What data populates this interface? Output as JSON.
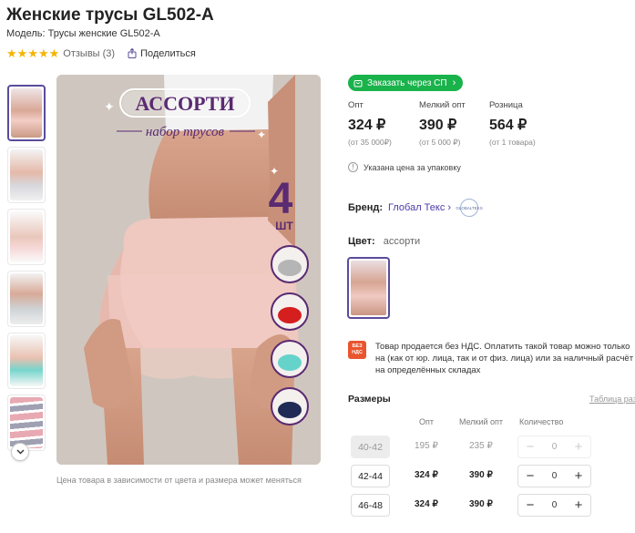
{
  "product": {
    "title": "Женские трусы GL502-A",
    "model": "Модель: Трусы женские GL502-A",
    "rating_stars": 5,
    "reviews": "Отзывы (3)",
    "share": "Поделиться"
  },
  "gallery": {
    "image_title": "АССОРТИ",
    "image_subtitle": "набор трусов",
    "image_count": "4",
    "image_count_unit": "ШТ",
    "caption": "Цена товара в зависимости от цвета и размера может меняться"
  },
  "order_button": "Заказать через СП",
  "prices": [
    {
      "label": "Опт",
      "value": "324 ₽",
      "note": "(от 35 000₽)"
    },
    {
      "label": "Мелкий опт",
      "value": "390 ₽",
      "note": "(от 5 000 ₽)"
    },
    {
      "label": "Розница",
      "value": "564 ₽",
      "note": "(от 1 товара)"
    }
  ],
  "price_info": "Указана цена за упаковку",
  "brand": {
    "label": "Бренд:",
    "value": "Глобал Текс",
    "logo_text": "GLOBALTEKS"
  },
  "color": {
    "label": "Цвет:",
    "value": "ассорти"
  },
  "vat": {
    "badge_line1": "БЕЗ",
    "badge_line2": "НДС",
    "text": "Товар продается без НДС. Оплатить такой товар можно только на (как от юр. лица, так и от физ. лица) или за наличный расчёт на определённых складах"
  },
  "sizes": {
    "title": "Размеры",
    "table_link": "Таблица раз",
    "headers": {
      "opt": "Опт",
      "small_opt": "Мелкий опт",
      "qty": "Количество"
    },
    "rows": [
      {
        "size": "40-42",
        "opt": "195 ₽",
        "small_opt": "235 ₽",
        "qty": "0",
        "disabled": true
      },
      {
        "size": "42-44",
        "opt": "324 ₽",
        "small_opt": "390 ₽",
        "qty": "0",
        "disabled": false
      },
      {
        "size": "46-48",
        "opt": "324 ₽",
        "small_opt": "390 ₽",
        "qty": "0",
        "disabled": false
      }
    ]
  },
  "colors": {
    "accent": "#19b24b",
    "link": "#4b3aa8",
    "selected_border": "#5b4b9b",
    "vat_badge": "#e9552e",
    "star": "#f5b400"
  },
  "icons": [
    "star-icon",
    "share-icon",
    "cart-icon",
    "chevron-right-icon",
    "chevron-down-icon",
    "info-icon",
    "minus-icon",
    "plus-icon"
  ]
}
